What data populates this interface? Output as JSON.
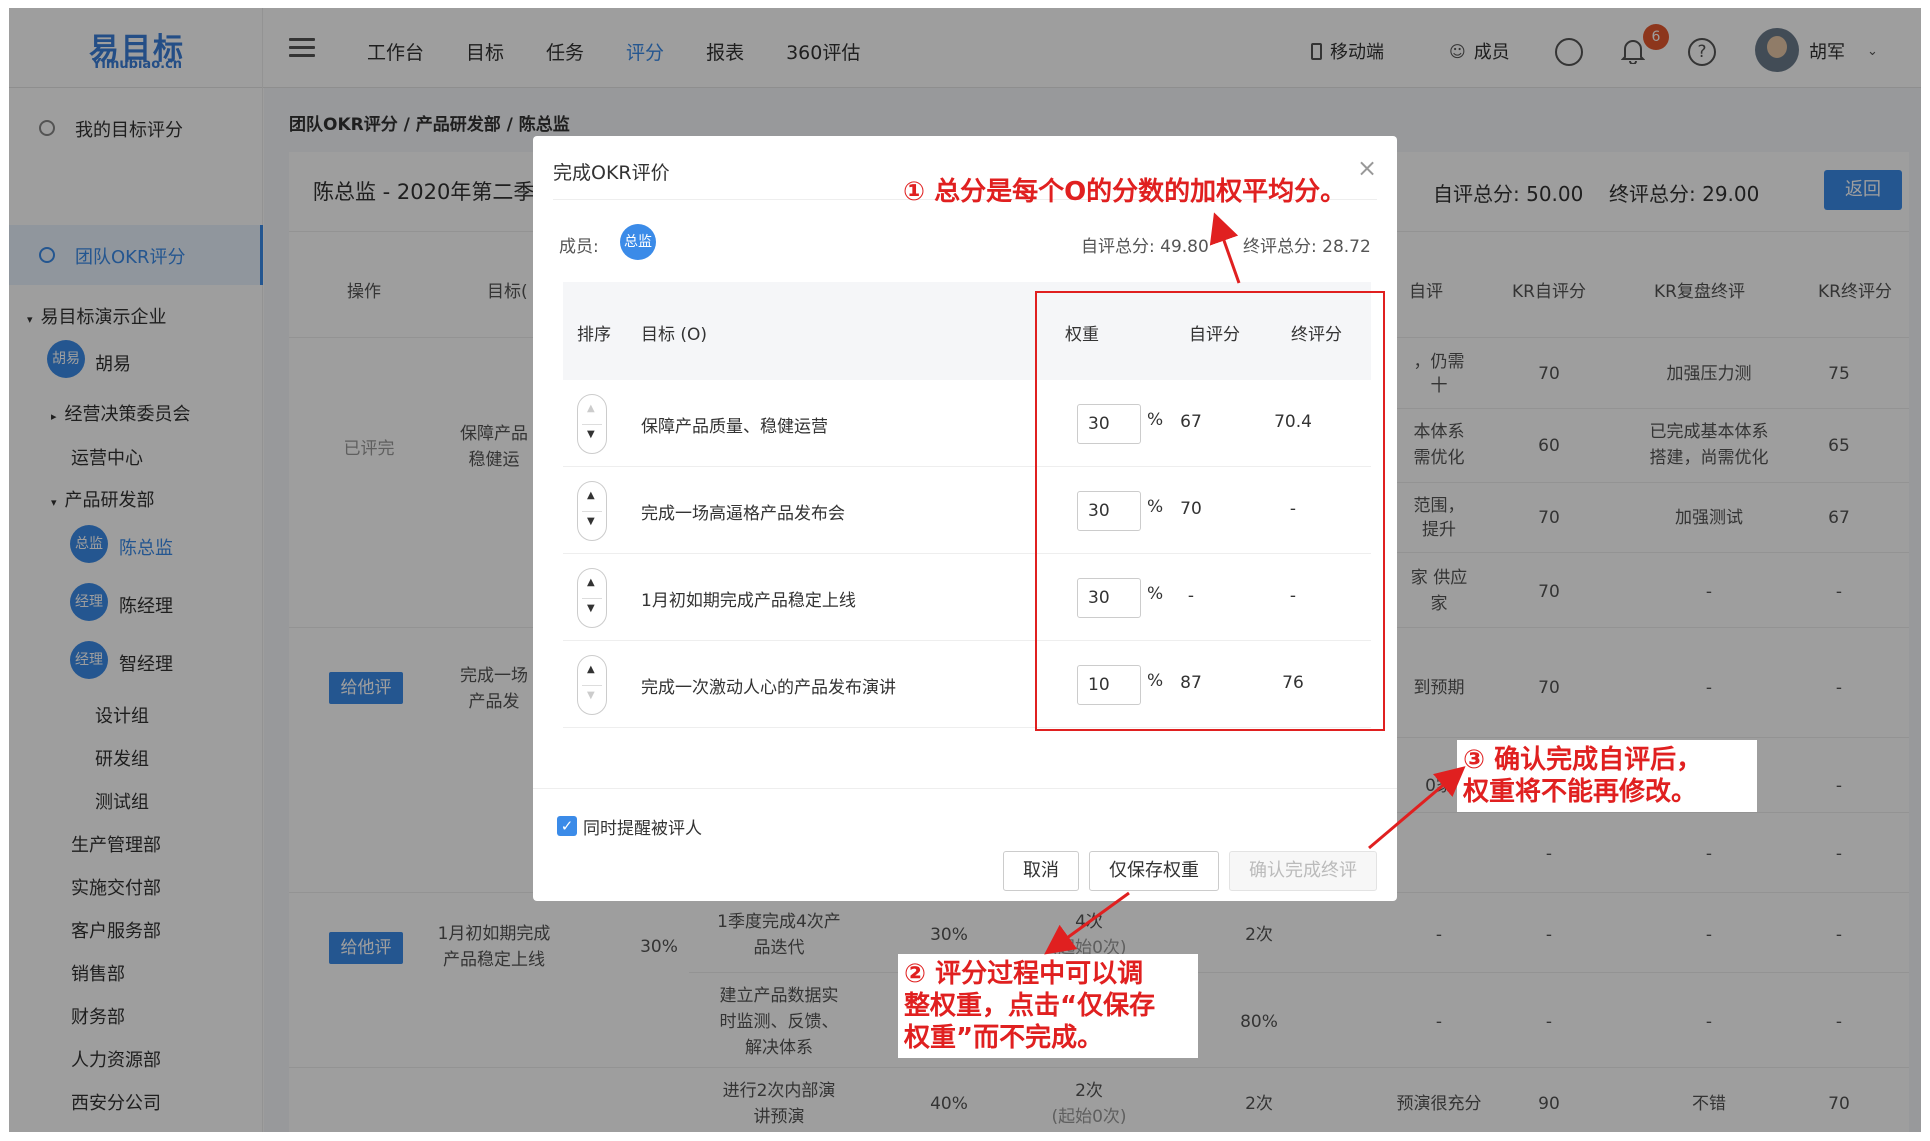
{
  "header": {
    "logo_cn": "易目标",
    "logo_en": "Yimubiao.cn",
    "nav": [
      {
        "label": "工作台"
      },
      {
        "label": "目标"
      },
      {
        "label": "任务"
      },
      {
        "label": "评分"
      },
      {
        "label": "报表"
      },
      {
        "label": "360评估"
      }
    ],
    "mobile": "移动端",
    "members": "成员",
    "notification_count": "6",
    "user_name": "胡军"
  },
  "sidebar": {
    "my_score": "我的目标评分",
    "team_score": "团队OKR评分",
    "company": "易目标演示企业",
    "hu_dot": "胡易",
    "hu_name": "胡易",
    "committee": "经营决策委员会",
    "ops": "运营中心",
    "rnd": "产品研发部",
    "chen_dot": "总监",
    "chen_name": "陈总监",
    "jl_dot": "经理",
    "jl_name": "陈经理",
    "zhi_dot": "经理",
    "zhi_name": "智经理",
    "design": "设计组",
    "dev": "研发组",
    "test": "测试组",
    "prod": "生产管理部",
    "delivery": "实施交付部",
    "cs": "客户服务部",
    "sales": "销售部",
    "finance": "财务部",
    "hr": "人力资源部",
    "xian": "西安分公司"
  },
  "main": {
    "breadcrumb": "团队OKR评分 / 产品研发部 / 陈总监",
    "title": "陈总监 - 2020年第二季",
    "self_total": "自评总分: 50.00",
    "final_total": "终评总分: 29.00",
    "back": "返回",
    "headers": {
      "op": "操作",
      "goal": "目标(",
      "self": "自评",
      "kr_self": "KR自评分",
      "kr_review": "KR复盘终评",
      "kr_final": "KR终评分"
    },
    "rows": [
      {
        "op": "已评完",
        "goal": "保障产品",
        "goal2": "稳健运",
        "self": "，仍需",
        "self2": "十",
        "kr_self": "70",
        "kr_review": "加强压力测",
        "kr_final": "75"
      },
      {
        "self": "本体系",
        "self2": "需优化",
        "kr_self": "60",
        "kr_review": "已完成基本体系",
        "kr_review2": "搭建，尚需优化",
        "kr_final": "65"
      },
      {
        "self": "范围，",
        "self2": "提升",
        "kr_self": "70",
        "kr_review": "加强测试",
        "kr_final": "67"
      },
      {
        "self": "家 供应",
        "self2": "家",
        "kr_self": "70",
        "kr_review": "-",
        "kr_final": "-"
      },
      {
        "op": "给他评",
        "goal": "完成一场",
        "goal2": "产品发",
        "self": "到预期",
        "kr_self": "70",
        "kr_review": "-",
        "kr_final": "-"
      },
      {
        "self": "0家",
        "kr_self": "-",
        "kr_review": "-",
        "kr_final": "-"
      },
      {
        "kr_self": "-",
        "kr_review": "-",
        "kr_final": "-"
      },
      {
        "op": "给他评",
        "goal": "1月初如期完成",
        "goal2": "产品稳定上线",
        "weight": "30%",
        "kr": "1季度完成4次产",
        "kr2": "品迭代",
        "kr_w": "30%",
        "target": "4次",
        "target2": "(起始0次)",
        "actual": "2次",
        "self": "-",
        "kr_self": "-",
        "kr_review": "-",
        "kr_final": "-"
      },
      {
        "kr": "建立产品数据实",
        "kr2": "时监测、反馈、",
        "kr3": "解决体系",
        "actual": "80%",
        "self": "-",
        "kr_self": "-",
        "kr_review": "-",
        "kr_final": "-"
      },
      {
        "kr": "进行2次内部演",
        "kr2": "讲预演",
        "kr_w": "40%",
        "target": "2次",
        "target2": "(起始0次)",
        "actual": "2次",
        "self": "预演很充分",
        "kr_self": "90",
        "kr_review": "不错",
        "kr_final": "70"
      }
    ]
  },
  "modal": {
    "title": "完成OKR评价",
    "member_label": "成员:",
    "member_dot": "总监",
    "self_total": "自评总分: 49.80",
    "final_total": "终评总分: 28.72",
    "col_order": "排序",
    "col_goal": "目标 (O)",
    "col_weight": "权重",
    "col_self": "自评分",
    "col_final": "终评分",
    "rows": [
      {
        "goal": "保障产品质量、稳健运营",
        "weight": "30",
        "self": "67",
        "final": "70.4"
      },
      {
        "goal": "完成一场高逼格产品发布会",
        "weight": "30",
        "self": "70",
        "final": "-"
      },
      {
        "goal": "1月初如期完成产品稳定上线",
        "weight": "30",
        "self": "-",
        "final": "-"
      },
      {
        "goal": "完成一次激动人心的产品发布演讲",
        "weight": "10",
        "self": "87",
        "final": "76"
      }
    ],
    "pct": "%",
    "remind": "同时提醒被评人",
    "cancel": "取消",
    "save_weight": "仅保存权重",
    "confirm": "确认完成终评"
  },
  "annotations": {
    "a1": "① 总分是每个O的分数的加权平均分。",
    "a2_l1": "② 评分过程中可以调",
    "a2_l2": "整权重，点击“仅保存",
    "a2_l3": "权重”而不完成。",
    "a3_l1": "③ 确认完成自评后，",
    "a3_l2": "权重将不能再修改。"
  },
  "colors": {
    "accent": "#3b8be8",
    "annotation": "#e02020"
  }
}
